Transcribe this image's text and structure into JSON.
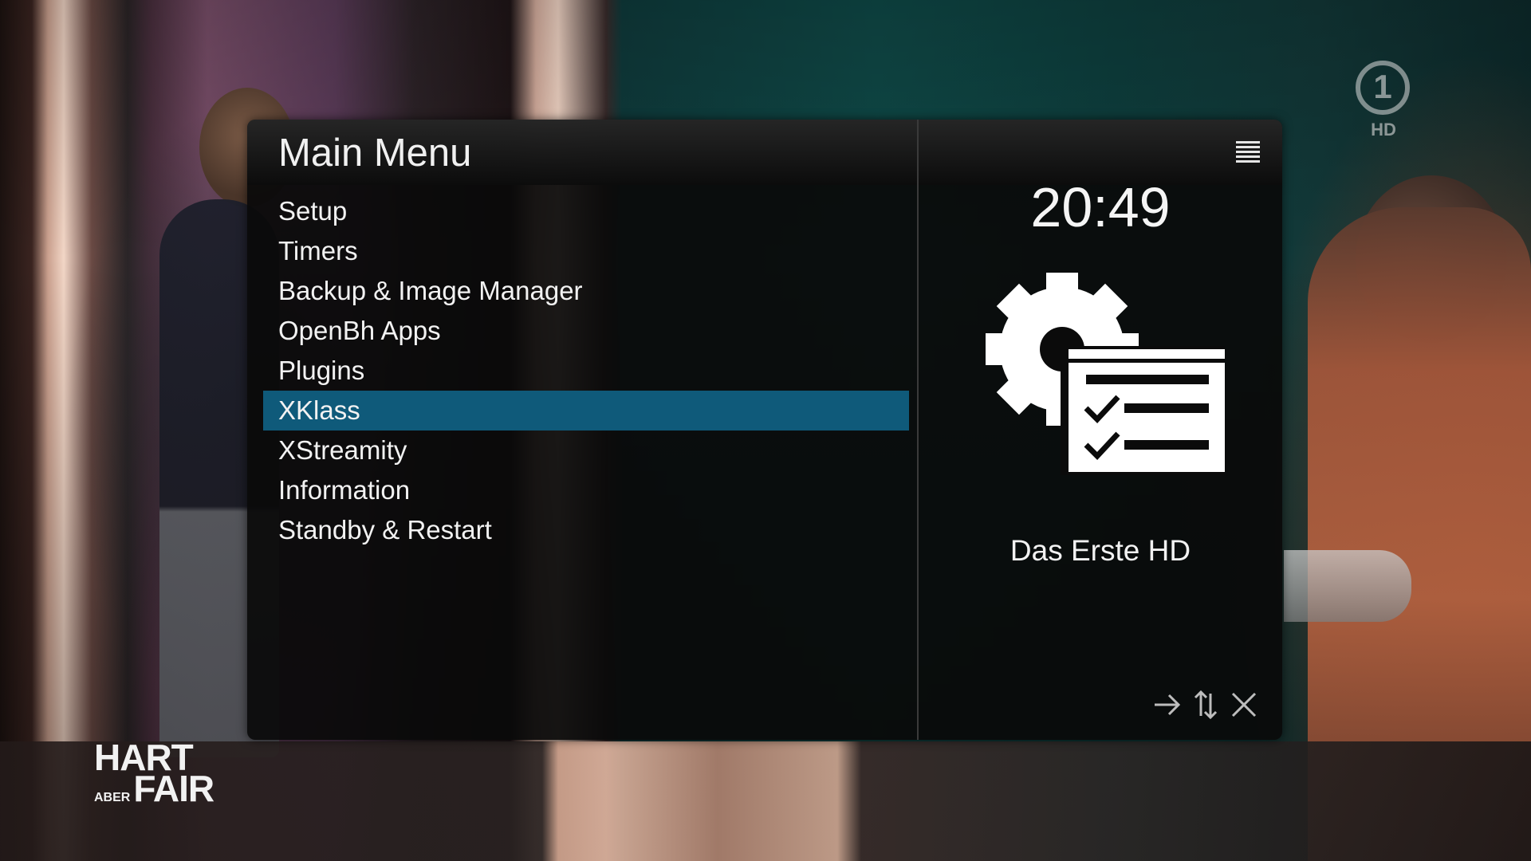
{
  "background": {
    "channel_logo": "1",
    "channel_badge": "HD",
    "show_logo": {
      "line1": "HART",
      "line2_small": "ABER",
      "line2_big": "FAIR"
    }
  },
  "dialog": {
    "title": "Main Menu",
    "menu_items": [
      {
        "label": "Setup"
      },
      {
        "label": "Timers"
      },
      {
        "label": "Backup & Image Manager"
      },
      {
        "label": "OpenBh Apps"
      },
      {
        "label": "Plugins"
      },
      {
        "label": "XKlass",
        "selected": true
      },
      {
        "label": "XStreamity"
      },
      {
        "label": "Information"
      },
      {
        "label": "Standby & Restart"
      }
    ],
    "clock": "20:49",
    "channel_name": "Das Erste HD",
    "icons": {
      "list_toggle": "list-icon",
      "preview": "settings-checklist-icon",
      "footer": [
        "arrow-right-icon",
        "up-down-arrows-icon",
        "close-icon"
      ]
    }
  },
  "colors": {
    "selection": "#0f5a7a",
    "panel_bg": "#0a0a0a",
    "text": "#f2f2f2"
  }
}
